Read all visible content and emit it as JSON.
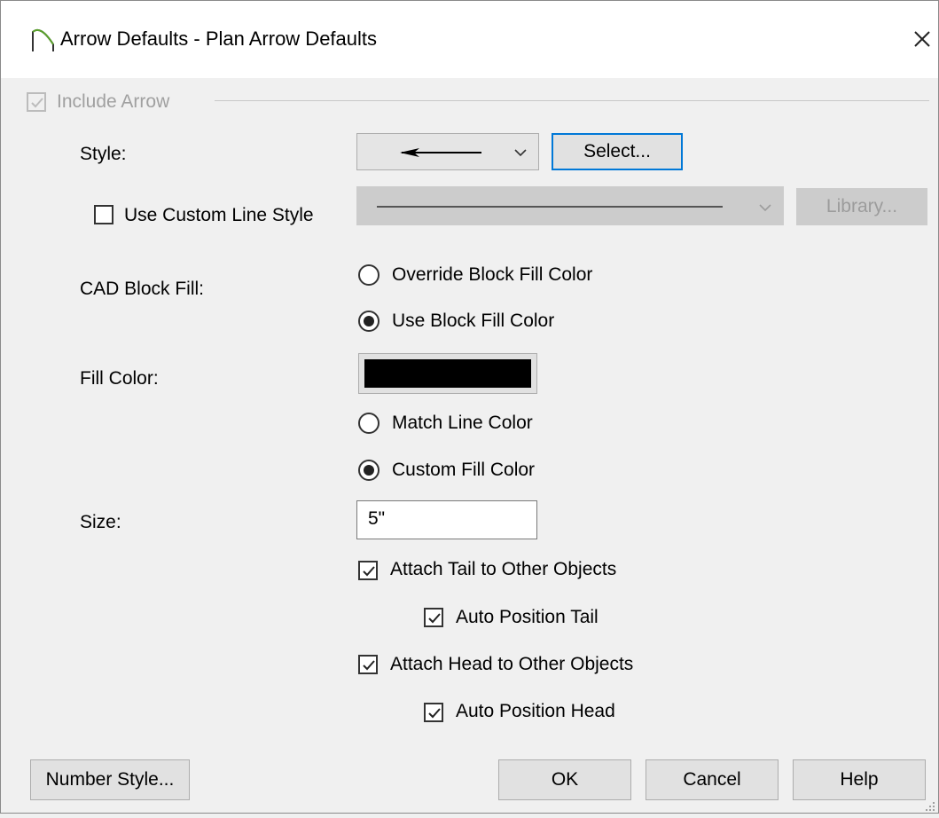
{
  "window": {
    "title": "Arrow Defaults - Plan Arrow Defaults",
    "app_icon": "arch-icon",
    "close_icon": "close-icon"
  },
  "include_arrow": {
    "label": "Include Arrow",
    "checked": true,
    "enabled": false
  },
  "style": {
    "label": "Style:",
    "selected_value": "arrow-line-preview",
    "select_button": "Select..."
  },
  "custom_line_style": {
    "label": "Use Custom Line Style",
    "checked": false,
    "library_button": "Library..."
  },
  "cad_block_fill": {
    "label": "CAD Block Fill:",
    "options": [
      {
        "label": "Override Block Fill Color",
        "selected": false
      },
      {
        "label": "Use Block Fill Color",
        "selected": true
      }
    ]
  },
  "fill_color": {
    "label": "Fill Color:",
    "color": "#000000",
    "options": [
      {
        "label": "Match Line Color",
        "selected": false
      },
      {
        "label": "Custom Fill Color",
        "selected": true
      }
    ]
  },
  "size": {
    "label": "Size:",
    "value": "5\""
  },
  "attach": {
    "tail": {
      "label": "Attach Tail to Other Objects",
      "checked": true
    },
    "auto_tail": {
      "label": "Auto Position Tail",
      "checked": true
    },
    "head": {
      "label": "Attach Head to Other Objects",
      "checked": true
    },
    "auto_head": {
      "label": "Auto Position Head",
      "checked": true
    }
  },
  "buttons": {
    "number_style": "Number Style...",
    "ok": "OK",
    "cancel": "Cancel",
    "help": "Help"
  },
  "colors": {
    "accent": "#0078d7",
    "dialog_bg": "#f0f0f0"
  }
}
